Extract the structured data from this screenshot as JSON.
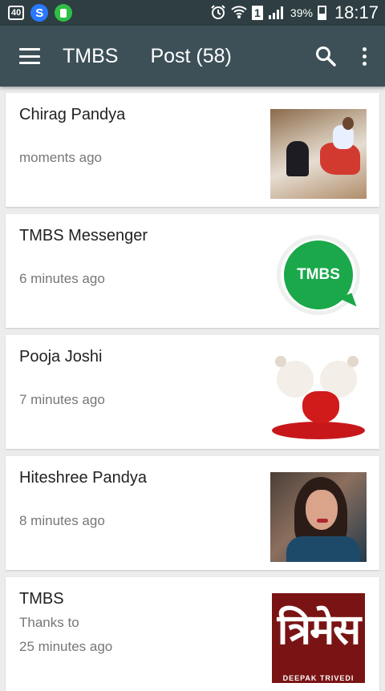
{
  "status_bar": {
    "badge": "40",
    "sim": "1",
    "battery": "39%",
    "time": "18:17"
  },
  "appbar": {
    "title": "TMBS",
    "post_count": "Post (58)"
  },
  "posts": [
    {
      "name": "Chirag Pandya",
      "time": "moments ago",
      "thumb": "photo"
    },
    {
      "name": "TMBS Messenger",
      "time": "6 minutes ago",
      "thumb": "logo",
      "logo_text": "TMBS"
    },
    {
      "name": "Pooja Joshi",
      "time": "7 minutes ago",
      "thumb": "teddy-bears"
    },
    {
      "name": "Hiteshree Pandya",
      "time": "8 minutes ago",
      "thumb": "portrait"
    },
    {
      "name": "TMBS",
      "subtitle": "Thanks to",
      "time": "25 minutes ago",
      "thumb": "brand-logo",
      "logo_glyph": "त्रिमेस",
      "logo_caption": "DEEPAK TRIVEDI"
    }
  ],
  "colors": {
    "statusbar": "#2e3e43",
    "appbar": "#3d5057",
    "background": "#ececec",
    "tmbs_green": "#1aa84a"
  }
}
